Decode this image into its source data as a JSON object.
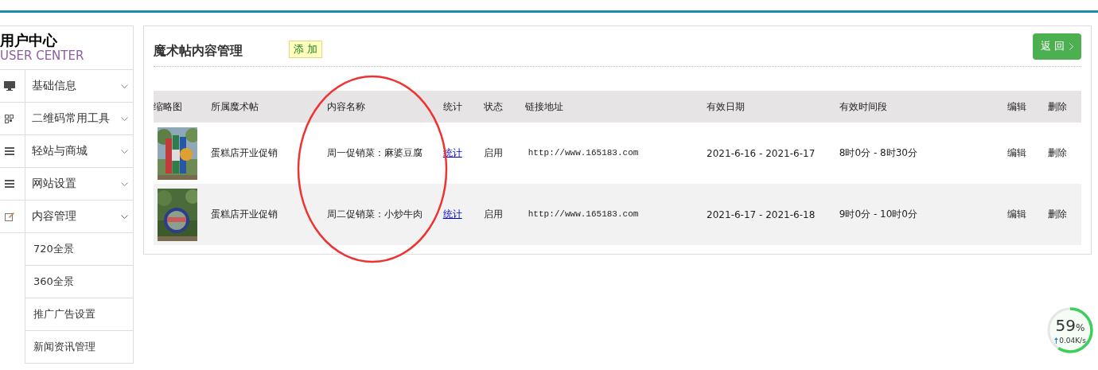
{
  "sidebar": {
    "title": "用户中心",
    "subtitle": "USER CENTER",
    "items": [
      {
        "label": "基础信息",
        "expanded": false
      },
      {
        "label": "二维码常用工具",
        "expanded": false
      },
      {
        "label": "轻站与商城",
        "expanded": false
      },
      {
        "label": "网站设置",
        "expanded": false
      },
      {
        "label": "内容管理",
        "expanded": true,
        "children": [
          {
            "label": "720全景"
          },
          {
            "label": "360全景"
          },
          {
            "label": "推广广告设置"
          },
          {
            "label": "新闻资讯管理"
          }
        ]
      }
    ]
  },
  "panel": {
    "title": "魔术帖内容管理",
    "add_button": "添 加",
    "back_button": "返 回",
    "table": {
      "columns": [
        "缩略图",
        "所属魔术帖",
        "内容名称",
        "统计",
        "状态",
        "链接地址",
        "有效日期",
        "有效时间段",
        "编辑",
        "删除"
      ],
      "rows": [
        {
          "post": "蛋糕店开业促销",
          "name": "周一促销菜：麻婆豆腐",
          "stats": "统计",
          "status": "启用",
          "url": "http://www.165183.com",
          "date": "2021-6-16 - 2021-6-17",
          "time": "8时0分 - 8时30分",
          "edit": "编辑",
          "delete": "删除"
        },
        {
          "post": "蛋糕店开业促销",
          "name": "周二促销菜：小炒牛肉",
          "stats": "统计",
          "status": "启用",
          "url": "http://www.165183.com",
          "date": "2021-6-17 - 2021-6-18",
          "time": "9时0分 - 10时0分",
          "edit": "编辑",
          "delete": "删除"
        }
      ]
    }
  },
  "speed_widget": {
    "value": "59",
    "unit": "%",
    "speed": "0.04K/s",
    "level": 0.59
  }
}
